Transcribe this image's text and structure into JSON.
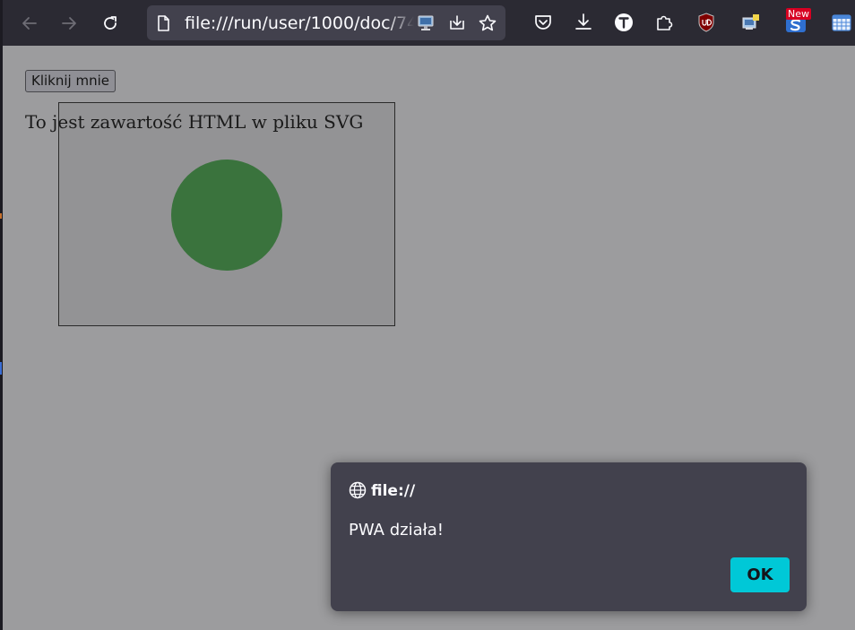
{
  "toolbar": {
    "url": "file:///run/user/1000/doc/74",
    "new_badge": "New"
  },
  "page": {
    "button_label": "Kliknij mnie",
    "html_text": "To jest zawartość HTML w pliku SVG",
    "circle_color": "#3a733d"
  },
  "dialog": {
    "origin": "file://",
    "message": "PWA działa!",
    "ok_label": "OK"
  },
  "colors": {
    "toolbar_bg": "#2b2a33",
    "urlbar_bg": "#42414d",
    "dialog_bg": "#42414d",
    "accent": "#00c8d7",
    "overlay_page": "#9c9c9e"
  }
}
